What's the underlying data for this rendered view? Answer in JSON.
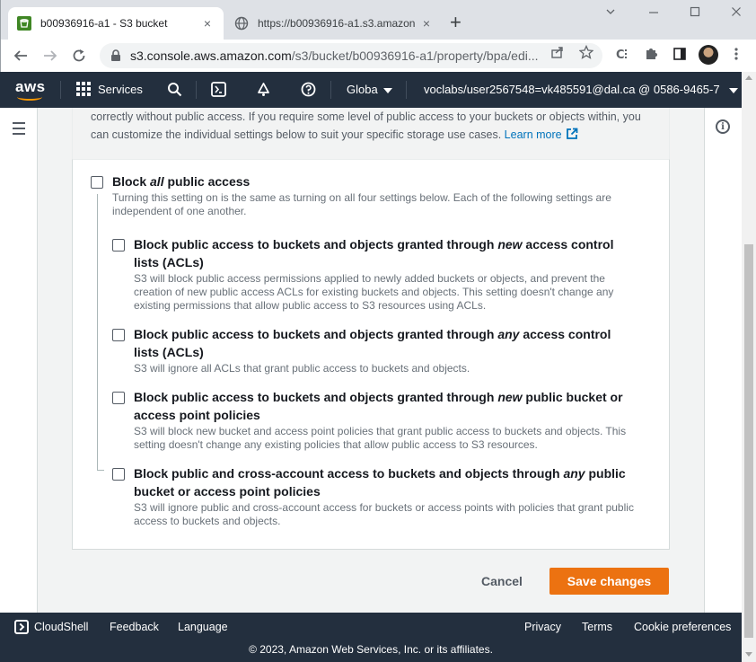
{
  "browser": {
    "tabs": [
      {
        "title": "b00936916-a1 - S3 bucket",
        "active": true
      },
      {
        "title": "https://b00936916-a1.s3.amazon",
        "active": false
      }
    ],
    "new_tab": "+",
    "close": "×",
    "url_domain": "s3.console.aws.amazon.com",
    "url_path": "/s3/bucket/b00936916-a1/property/bpa/edi..."
  },
  "aws_nav": {
    "logo": "aws",
    "services_label": "Services",
    "region_label": "Globa",
    "account_label": "voclabs/user2567548=vk485591@dal.ca @ 0586-9465-7"
  },
  "intro": {
    "line1": "correctly without public access. If you require some level of public access to your buckets or objects within, you",
    "line2": "can customize the individual settings below to suit your specific storage use cases.",
    "learn_more": "Learn more"
  },
  "block_all": {
    "title_pre": "Block ",
    "title_em": "all",
    "title_post": " public access",
    "desc": "Turning this setting on is the same as turning on all four settings below. Each of the following settings are independent of one another."
  },
  "options": [
    {
      "title_pre": "Block public access to buckets and objects granted through ",
      "title_em": "new",
      "title_post": " access control lists (ACLs)",
      "desc": "S3 will block public access permissions applied to newly added buckets or objects, and prevent the creation of new public access ACLs for existing buckets and objects. This setting doesn't change any existing permissions that allow public access to S3 resources using ACLs."
    },
    {
      "title_pre": "Block public access to buckets and objects granted through ",
      "title_em": "any",
      "title_post": " access control lists (ACLs)",
      "desc": "S3 will ignore all ACLs that grant public access to buckets and objects."
    },
    {
      "title_pre": "Block public access to buckets and objects granted through ",
      "title_em": "new",
      "title_post": " public bucket or access point policies",
      "desc": "S3 will block new bucket and access point policies that grant public access to buckets and objects. This setting doesn't change any existing policies that allow public access to S3 resources."
    },
    {
      "title_pre": "Block public and cross-account access to buckets and objects through ",
      "title_em": "any",
      "title_post": " public bucket or access point policies",
      "desc": "S3 will ignore public and cross-account access for buckets or access points with policies that grant public access to buckets and objects."
    }
  ],
  "actions": {
    "cancel": "Cancel",
    "save": "Save changes"
  },
  "footer": {
    "cloudshell": "CloudShell",
    "feedback": "Feedback",
    "language": "Language",
    "privacy": "Privacy",
    "terms": "Terms",
    "cookies": "Cookie preferences",
    "copyright": "© 2023, Amazon Web Services, Inc. or its affiliates."
  },
  "colors": {
    "aws_nav": "#232f3e",
    "accent_orange": "#ec7211",
    "link_blue": "#0073bb"
  }
}
